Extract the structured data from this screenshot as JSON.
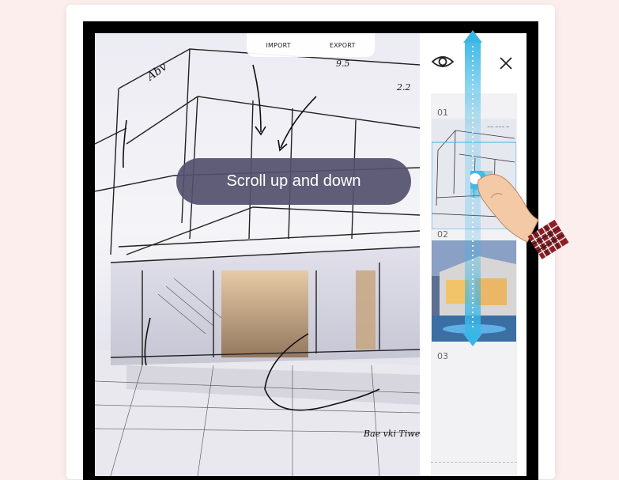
{
  "menu": {
    "import_label": "IMPORT",
    "export_label": "EXPORT"
  },
  "tooltip": {
    "text": "Scroll up and down"
  },
  "pages": [
    {
      "number": "01"
    },
    {
      "number": "02"
    },
    {
      "number": "03"
    }
  ],
  "sketch_notes": {
    "note_top": "Abv",
    "note_dim1": "9.5",
    "note_dim2": "2.2",
    "note_bottom": "Bae vki Tiwe longe"
  },
  "icons": {
    "visibility": "eye-icon",
    "close": "close-icon",
    "scroll_guide": "double-arrow-icon",
    "pointer": "hand-pointer-icon"
  },
  "colors": {
    "background": "#fbeeed",
    "tooltip": "#54506e",
    "highlight": "#39b6e6",
    "panel": "#f2f1f4"
  }
}
